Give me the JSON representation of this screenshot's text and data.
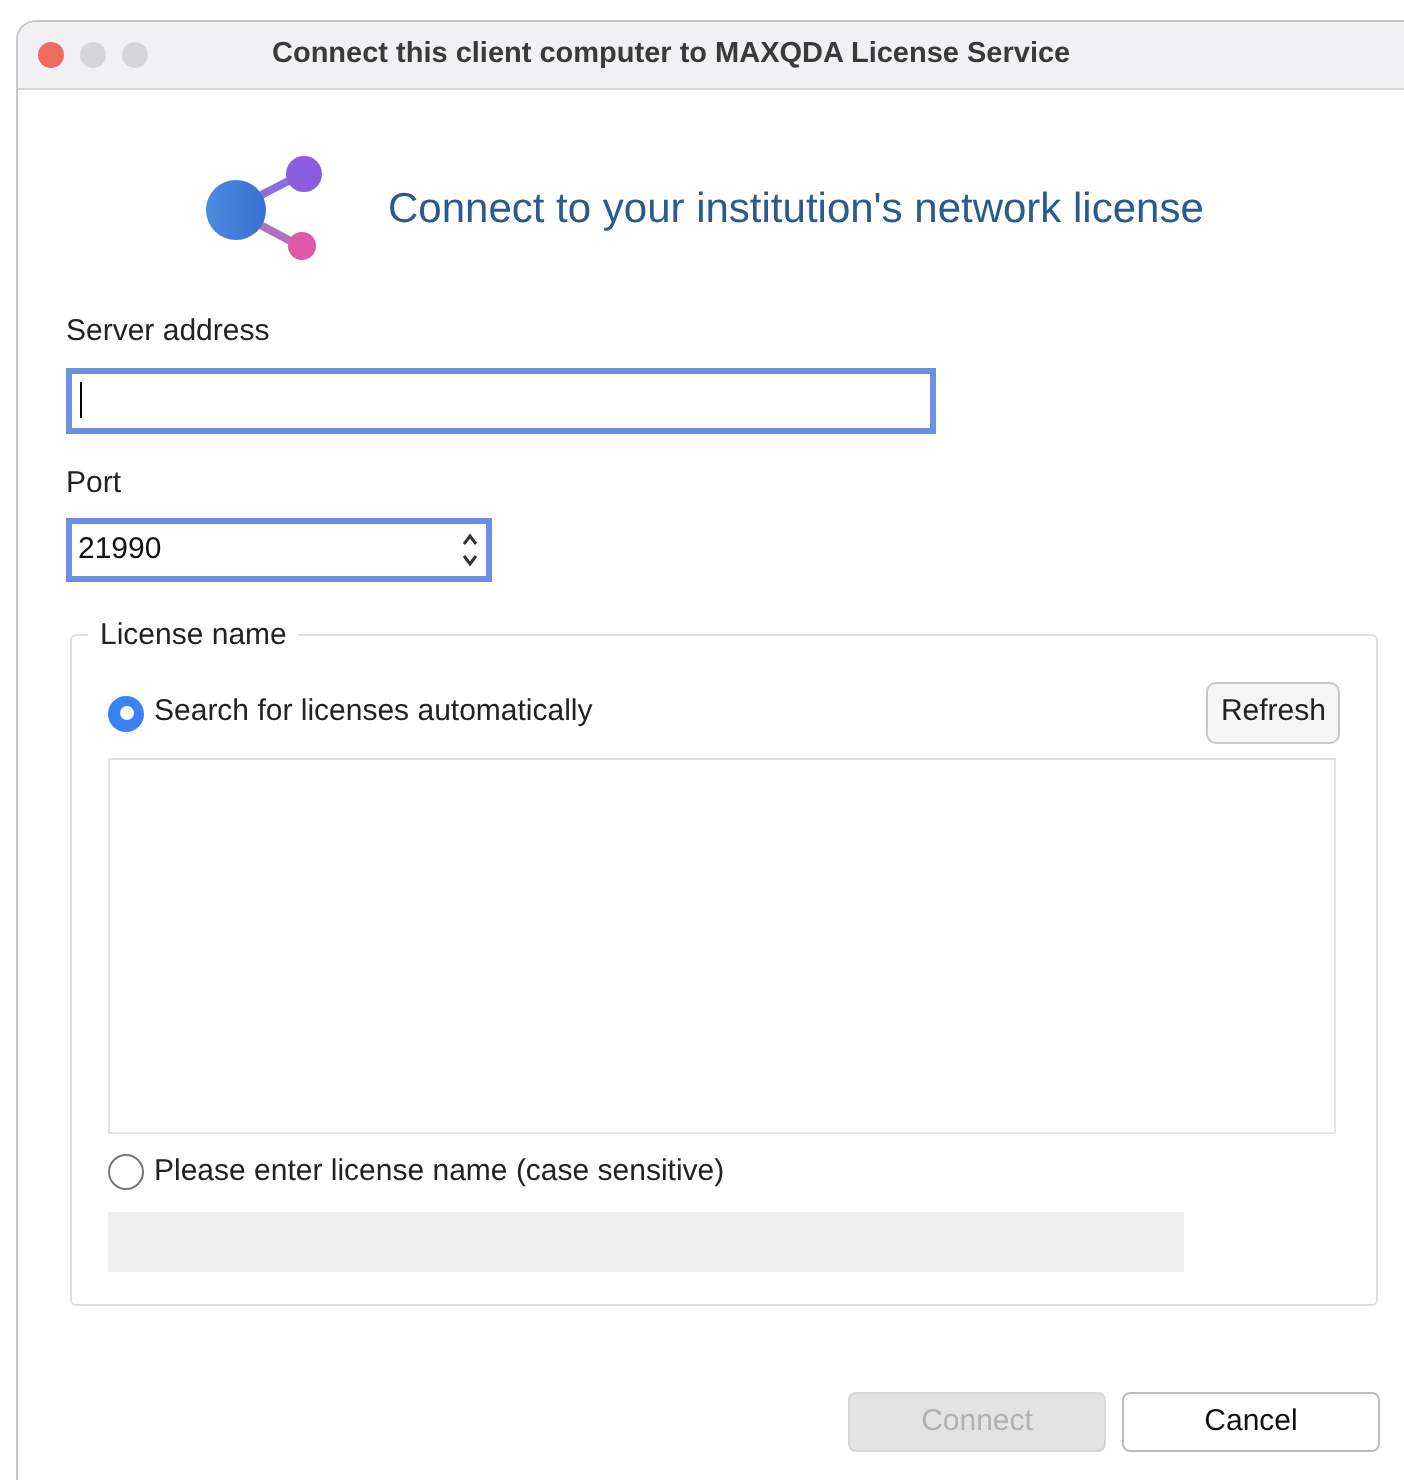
{
  "window": {
    "title": "Connect this client computer to MAXQDA License Service"
  },
  "heading": "Connect to your institution's network license",
  "server_address": {
    "label": "Server address",
    "focused": true
  },
  "port": {
    "label": "Port",
    "value": "21990",
    "focused": true
  },
  "license_group": {
    "label": "License name",
    "options": [
      {
        "label": "Search for licenses automatically",
        "selected": true
      },
      {
        "label": "Please enter license name (case sensitive)",
        "selected": false
      }
    ],
    "refresh_button": "Refresh",
    "license_name_field": {
      "disabled": true
    }
  },
  "buttons": [
    {
      "label": "Connect",
      "disabled": true
    },
    {
      "label": "Cancel",
      "disabled": false
    }
  ]
}
